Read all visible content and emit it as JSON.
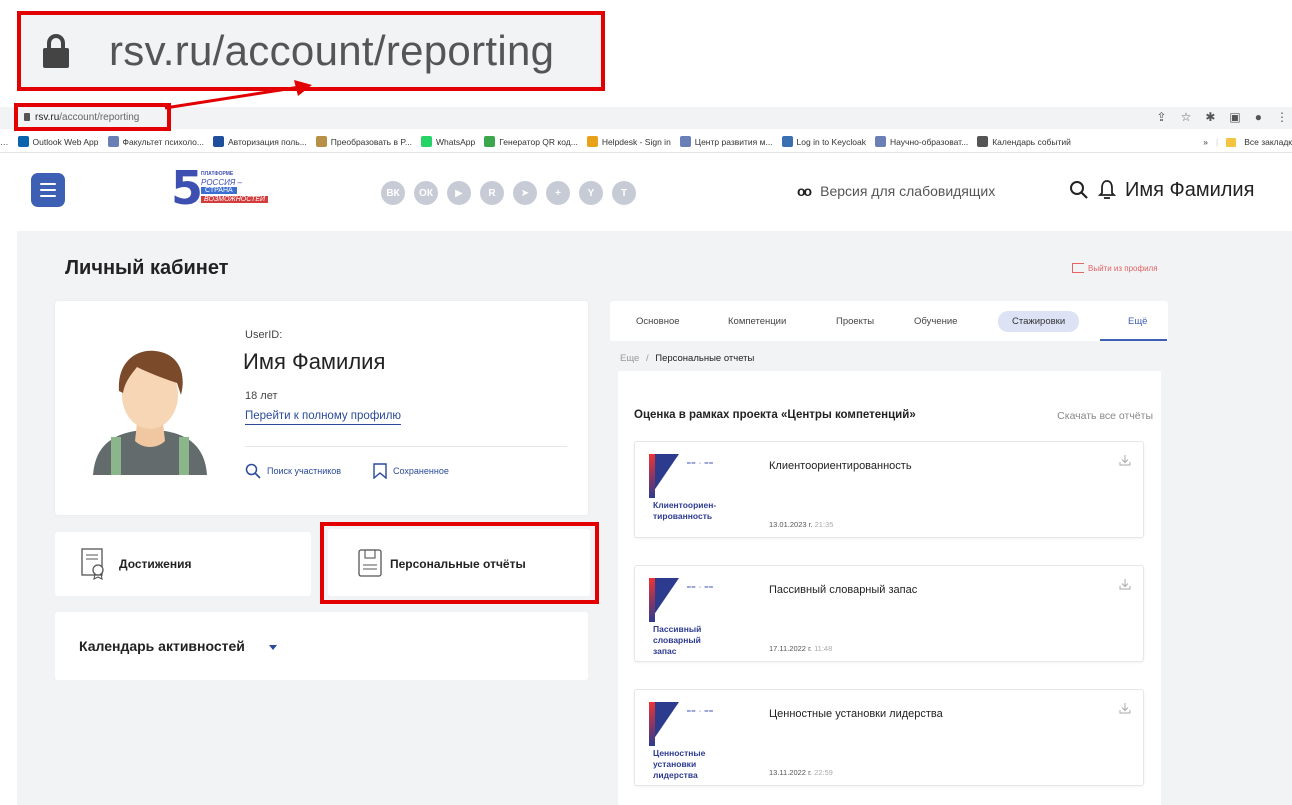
{
  "zoom_callout": {
    "url": "rsv.ru/account/reporting"
  },
  "browser": {
    "address": {
      "host": "rsv.ru",
      "path": "/account/reporting"
    },
    "bookmarks": [
      {
        "label": "…",
        "icon": "ellipsis-icon",
        "color": "#ffffff"
      },
      {
        "label": "Outlook Web App",
        "icon": "outlook-icon",
        "color": "#0a64ad"
      },
      {
        "label": "Факультет психоло...",
        "icon": "university-icon",
        "color": "#6a7fb5"
      },
      {
        "label": "Авторизация поль...",
        "icon": "m-icon",
        "color": "#1f4e9c"
      },
      {
        "label": "Преобразовать в P...",
        "icon": "pdf-icon",
        "color": "#b78f46"
      },
      {
        "label": "WhatsApp",
        "icon": "whatsapp-icon",
        "color": "#25d366"
      },
      {
        "label": "Генератор QR код...",
        "icon": "qr-icon",
        "color": "#3aa74c"
      },
      {
        "label": "Helpdesk - Sign in",
        "icon": "helpdesk-icon",
        "color": "#e8a21a"
      },
      {
        "label": "Центр развития м...",
        "icon": "university-icon",
        "color": "#6a7fb5"
      },
      {
        "label": "Log in to Keycloak",
        "icon": "keycloak-icon",
        "color": "#3a6fb0"
      },
      {
        "label": "Научно-образоват...",
        "icon": "university-icon",
        "color": "#6a7fb5"
      },
      {
        "label": "Календарь событий",
        "icon": "globe-icon",
        "color": "#555555"
      }
    ],
    "bookmarks_overflow": "»",
    "all_bookmarks": "Все закладк"
  },
  "header": {
    "socials": [
      "vk",
      "ok",
      "yt",
      "rt",
      "tg",
      "plus",
      "y",
      "t"
    ],
    "socials_glyphs": [
      "ВК",
      "ОК",
      "▶",
      "R",
      "➤",
      "+",
      "Y",
      "T"
    ],
    "vision_icon": "ᴏᴏ",
    "vision_label": "Версия для слабовидящих",
    "user_name": "Имя Фамилия",
    "logo": {
      "num": "5",
      "l1": "ПЛАТФОРМЕ",
      "l2": "РОССИЯ –",
      "l3": "СТРАНА",
      "l4": "ВОЗМОЖНОСТЕЙ"
    }
  },
  "page": {
    "title": "Личный кабинет",
    "logout": "Выйти из профиля"
  },
  "profile": {
    "userid_label": "UserID:",
    "name": "Имя Фамилия",
    "age": "18 лет",
    "full_profile_link": "Перейти к полному профилю",
    "search_label": "Поиск участников",
    "saved_label": "Сохраненное"
  },
  "tiles": {
    "achievements": "Достижения",
    "personal_reports": "Персональные отчёты",
    "calendar": "Календарь активностей"
  },
  "tabs": [
    {
      "label": "Основное"
    },
    {
      "label": "Компетенции"
    },
    {
      "label": "Проекты"
    },
    {
      "label": "Обучение"
    },
    {
      "label": "Стажировки"
    },
    {
      "label": "Ещё"
    }
  ],
  "breadcrumbs": {
    "parent": "Еще",
    "sep": "/",
    "current": "Персональные отчеты"
  },
  "reports_section": {
    "title": "Оценка в рамках проекта «Центры компетенций»",
    "download_all": "Скачать все отчёты",
    "thumb_logo": "━━  ◦ ━━",
    "items": [
      {
        "title": "Клиентоориентированность",
        "thumb": "Клиентоориен-\nтированность",
        "date": "13.01.2023 г.",
        "time": "21:35"
      },
      {
        "title": "Пассивный словарный запас",
        "thumb": "Пассивный\nсловарный\nзапас",
        "date": "17.11.2022 г.",
        "time": "11:48"
      },
      {
        "title": "Ценностные установки лидерства",
        "thumb": "Ценностные\nустановки\nлидерства",
        "date": "13.11.2022 г.",
        "time": "22:59"
      }
    ]
  },
  "colors": {
    "accent": "#3d5fb4",
    "highlight": "#e30000",
    "logout": "#e46363"
  }
}
